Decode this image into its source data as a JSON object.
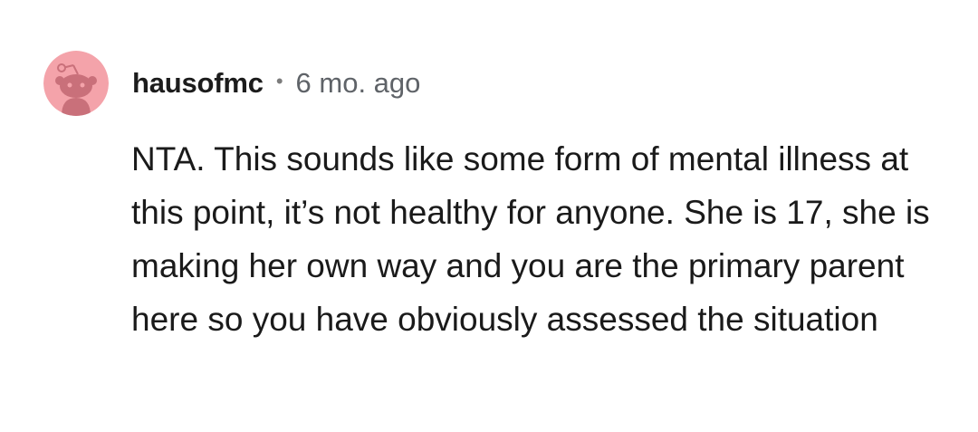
{
  "comment": {
    "author": "hausofmc",
    "separator": "•",
    "age": "6 mo. ago",
    "avatar_icon": "snoo-avatar-icon",
    "body": "NTA. This sounds like some form of mental illness at this point, it’s not healthy for anyone. She is 17, she is making her own way and you are the primary parent here so you have obviously assessed the situation"
  },
  "colors": {
    "avatar_bg": "#f4a3aa",
    "avatar_figure": "#c9707a",
    "text": "#1a1a1a",
    "meta": "#5f6368"
  }
}
